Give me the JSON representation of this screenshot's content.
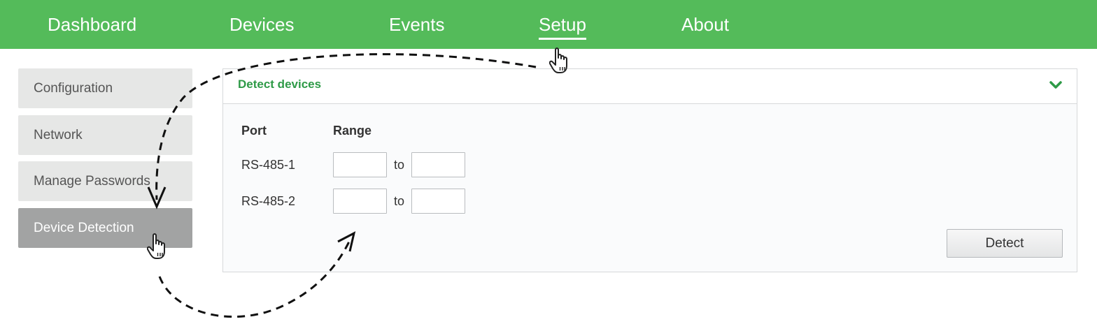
{
  "nav": {
    "items": [
      {
        "label": "Dashboard"
      },
      {
        "label": "Devices"
      },
      {
        "label": "Events"
      },
      {
        "label": "Setup",
        "active": true
      },
      {
        "label": "About"
      }
    ]
  },
  "sidebar": {
    "items": [
      {
        "label": "Configuration"
      },
      {
        "label": "Network"
      },
      {
        "label": "Manage Passwords"
      },
      {
        "label": "Device Detection",
        "active": true
      }
    ]
  },
  "panel": {
    "title": "Detect devices",
    "port_header": "Port",
    "range_header": "Range",
    "rows": [
      {
        "port": "RS-485-1",
        "from": "",
        "to_label": "to",
        "to": ""
      },
      {
        "port": "RS-485-2",
        "from": "",
        "to_label": "to",
        "to": ""
      }
    ],
    "detect_label": "Detect"
  },
  "colors": {
    "nav_bg": "#54bb5a",
    "accent_green": "#2e9a47",
    "sidebar_bg": "#e6e7e6",
    "sidebar_active_bg": "#a2a3a3"
  },
  "icons": {
    "collapse": "chevron-down-icon",
    "cursor": "hand-pointer-icon",
    "annotation": "dashed-arrow"
  }
}
